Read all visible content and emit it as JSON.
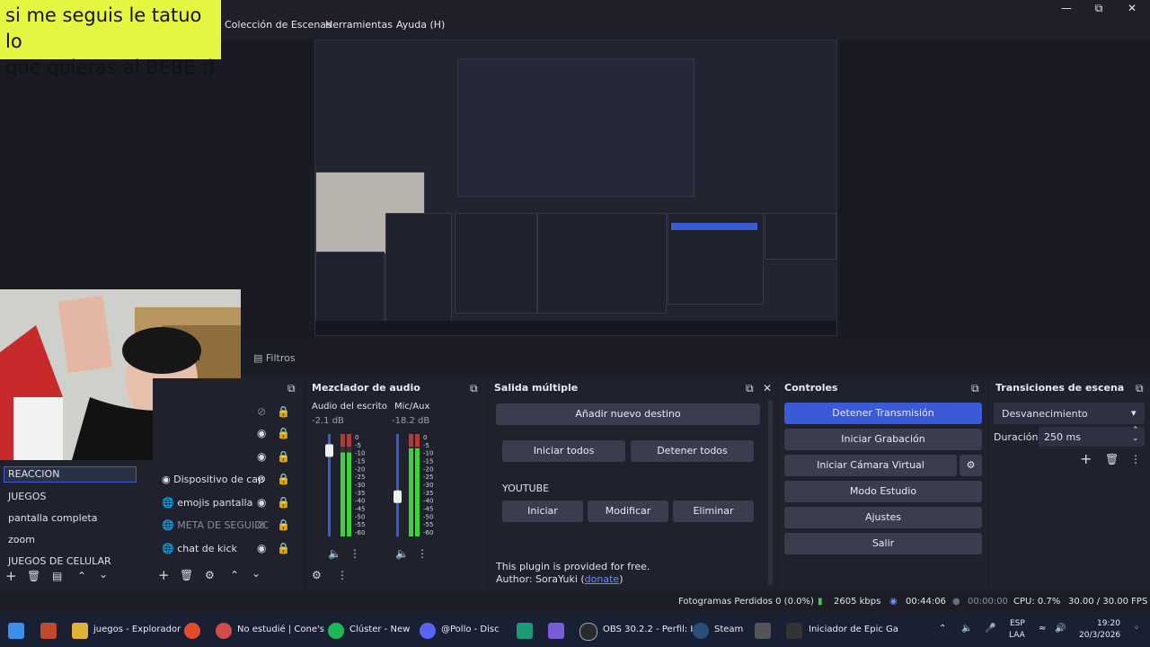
{
  "menubar": {
    "items": [
      "Colección de Escenas",
      "Herramientas",
      "Ayuda (H)"
    ]
  },
  "overlay": {
    "caption_line1": "si me seguis le tatuo lo",
    "caption_line2": "que quieras al BEBE :)"
  },
  "filters_button": "Filtros",
  "scenes": {
    "items": [
      "REACCION",
      "JUEGOS",
      "pantalla completa",
      "zoom",
      "JUEGOS DE CELULAR"
    ],
    "selected": 0
  },
  "sources": {
    "items": [
      {
        "label": "Dispositivo de cap",
        "visible": true
      },
      {
        "label": "emojis pantalla",
        "visible": true
      },
      {
        "label": "META DE SEGUIDC",
        "visible": false
      },
      {
        "label": "chat de kick",
        "visible": true
      }
    ]
  },
  "audio_mixer": {
    "title": "Mezclador de audio",
    "channels": [
      {
        "name": "Audio del escrito",
        "db": "-2.1 dB",
        "level": 0.82,
        "fader": 0.9
      },
      {
        "name": "Mic/Aux",
        "db": "-18.2 dB",
        "level": 0.86,
        "fader": 0.45
      }
    ],
    "scale": [
      "0",
      "-5",
      "-10",
      "-15",
      "-20",
      "-25",
      "-30",
      "-35",
      "-40",
      "-45",
      "-50",
      "-55",
      "-60"
    ]
  },
  "multi_output": {
    "title": "Salida múltiple",
    "add_destination": "Añadir nuevo destino",
    "start_all": "Iniciar todos",
    "stop_all": "Detener todos",
    "destination_name": "YOUTUBE",
    "start": "Iniciar",
    "modify": "Modificar",
    "delete": "Eliminar",
    "plugin_note": "This plugin is provided for free.",
    "author_prefix": "Author: SoraYuki (",
    "donate": "donate",
    "author_suffix": ")"
  },
  "controls": {
    "title": "Controles",
    "stop_stream": "Detener Transmisión",
    "start_recording": "Iniciar Grabación",
    "start_virtual_cam": "Iniciar Cámara Virtual",
    "studio_mode": "Modo Estudio",
    "settings": "Ajustes",
    "exit": "Salir"
  },
  "transitions": {
    "title": "Transiciones de escena",
    "selected": "Desvanecimiento",
    "duration_label": "Duración",
    "duration_value": "250 ms"
  },
  "statusbar": {
    "dropped_frames": "Fotogramas Perdidos 0 (0.0%)",
    "bitrate": "2605 kbps",
    "stream_time": "00:44:06",
    "rec_time": "00:00:00",
    "cpu": "CPU: 0.7%",
    "fps": "30.00 / 30.00 FPS"
  },
  "taskbar": {
    "apps": [
      {
        "label": "juegos - Explorador"
      },
      {
        "label": "No estudié | Cone's"
      },
      {
        "label": "Clúster - New"
      },
      {
        "label": "@Pollo  - Disc"
      },
      {
        "label": "OBS 30.2.2 - Perfil: I"
      },
      {
        "label": "Steam"
      },
      {
        "label": "Iniciador de Epic Ga"
      }
    ],
    "lang_line1": "ESP",
    "lang_line2": "LAA",
    "time": "19:20",
    "date": "20/3/2026"
  },
  "colors": {
    "accent_blue": "#3a5ad8",
    "caption_bg": "#e6f53f",
    "meter_green": "#3fcf3f",
    "meter_red": "#d83a3a"
  }
}
